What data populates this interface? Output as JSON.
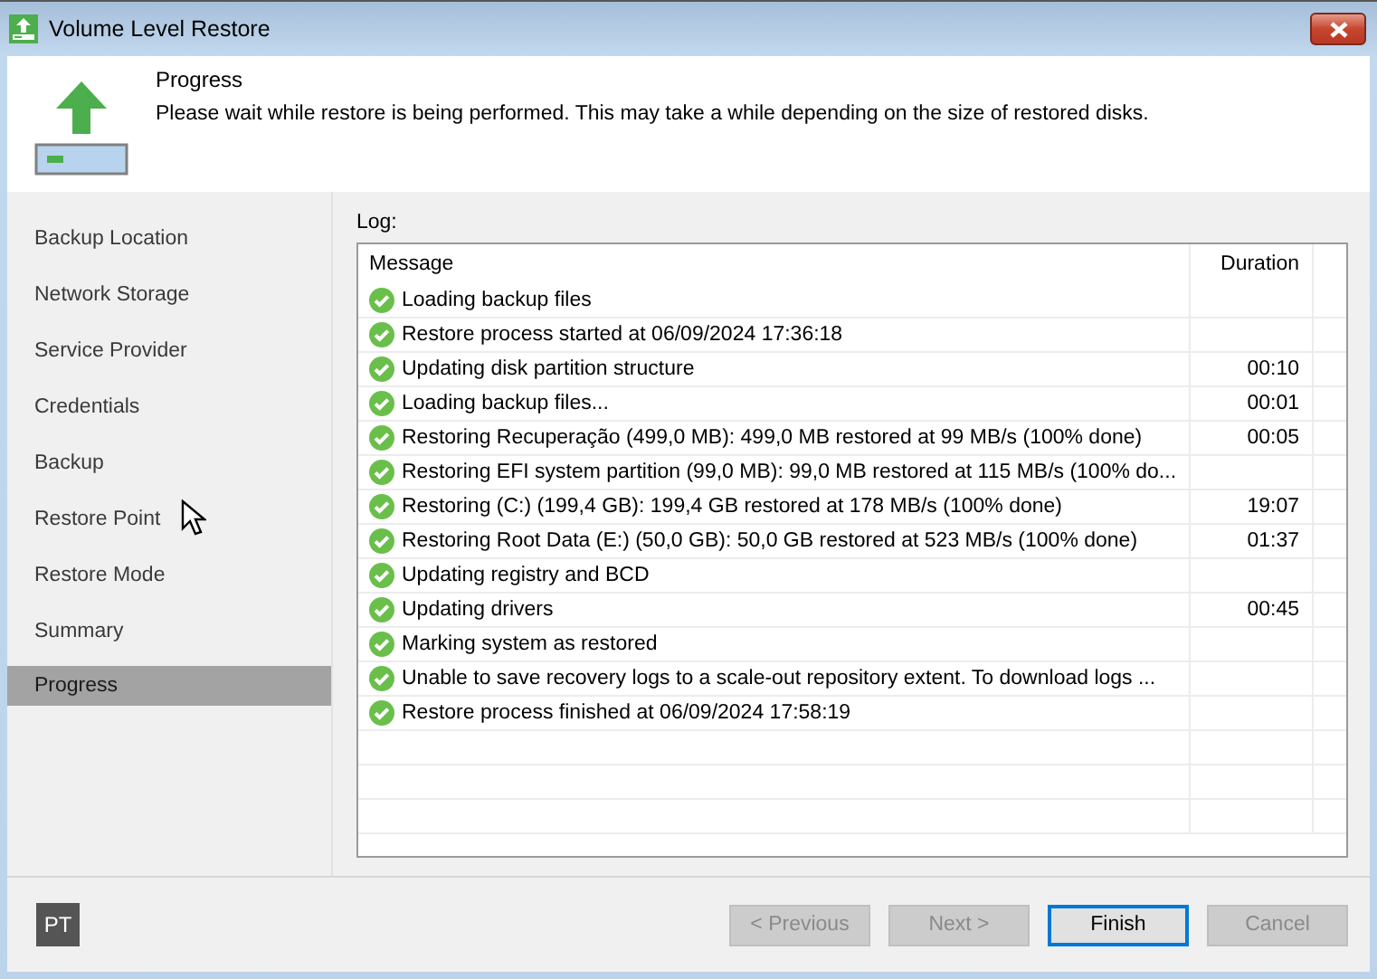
{
  "window": {
    "title": "Volume Level Restore"
  },
  "header": {
    "title": "Progress",
    "description": "Please wait while restore is being performed. This may take a while depending on the size of restored disks."
  },
  "sidebar": {
    "items": [
      {
        "label": "Backup Location",
        "selected": false
      },
      {
        "label": "Network Storage",
        "selected": false
      },
      {
        "label": "Service Provider",
        "selected": false
      },
      {
        "label": "Credentials",
        "selected": false
      },
      {
        "label": "Backup",
        "selected": false
      },
      {
        "label": "Restore Point",
        "selected": false
      },
      {
        "label": "Restore Mode",
        "selected": false
      },
      {
        "label": "Summary",
        "selected": false
      },
      {
        "label": "Progress",
        "selected": true
      }
    ]
  },
  "log": {
    "label": "Log:",
    "columns": [
      "Message",
      "Duration"
    ],
    "rows": [
      {
        "message": "Loading backup files",
        "duration": ""
      },
      {
        "message": "Restore process started at 06/09/2024 17:36:18",
        "duration": ""
      },
      {
        "message": "Updating disk partition structure",
        "duration": "00:10"
      },
      {
        "message": "Loading backup files...",
        "duration": "00:01"
      },
      {
        "message": "Restoring Recuperação (499,0 MB): 499,0 MB restored at 99 MB/s (100% done)",
        "duration": "00:05"
      },
      {
        "message": "Restoring EFI system partition (99,0 MB): 99,0 MB restored at 115 MB/s (100% do...",
        "duration": ""
      },
      {
        "message": "Restoring (C:) (199,4 GB): 199,4 GB restored at 178 MB/s (100% done)",
        "duration": "19:07"
      },
      {
        "message": "Restoring Root Data (E:) (50,0 GB): 50,0 GB restored at 523 MB/s (100% done)",
        "duration": "01:37"
      },
      {
        "message": "Updating registry and BCD",
        "duration": ""
      },
      {
        "message": "Updating drivers",
        "duration": "00:45"
      },
      {
        "message": "Marking system as restored",
        "duration": ""
      },
      {
        "message": "Unable to save recovery logs to a scale-out repository extent. To download logs ...",
        "duration": ""
      },
      {
        "message": "Restore process finished at 06/09/2024 17:58:19",
        "duration": ""
      }
    ]
  },
  "footer": {
    "avatar": "PT",
    "buttons": [
      {
        "label": "< Previous",
        "disabled": true,
        "focused": false
      },
      {
        "label": "Next >",
        "disabled": true,
        "focused": false
      },
      {
        "label": "Finish",
        "disabled": false,
        "focused": true
      },
      {
        "label": "Cancel",
        "disabled": true,
        "focused": false
      }
    ]
  }
}
